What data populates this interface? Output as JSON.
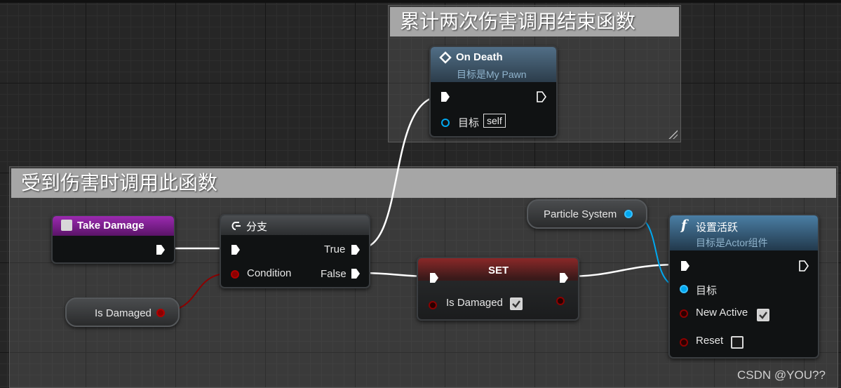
{
  "comments": {
    "top_title": "累计两次伤害调用结束函数",
    "main_title": "受到伤害时调用此函数"
  },
  "on_death": {
    "title": "On Death",
    "subtitle": "目标是My Pawn",
    "target_label": "目标",
    "self_value": "self"
  },
  "take_damage": {
    "title": "Take Damage"
  },
  "branch": {
    "title": "分支",
    "true_label": "True",
    "false_label": "False",
    "condition_label": "Condition"
  },
  "is_damaged_var": {
    "label": "Is Damaged"
  },
  "set_node": {
    "title": "SET",
    "var_label": "Is Damaged",
    "checked": true
  },
  "particle_var": {
    "label": "Particle System"
  },
  "set_active": {
    "title": "设置活跃",
    "subtitle": "目标是Actor组件",
    "target_label": "目标",
    "new_active_label": "New Active",
    "new_active_checked": true,
    "reset_label": "Reset",
    "reset_checked": false
  },
  "watermark": "CSDN @YOU??",
  "colors": {
    "exec": "#ffffff",
    "bool_pin": "#8c0000",
    "object_pin": "#00a8f0",
    "event_header": "#8a1e9a",
    "function_header": "#3c6d8f",
    "set_header": "#7a1e1e",
    "comment_title": "#a6a6a6"
  }
}
